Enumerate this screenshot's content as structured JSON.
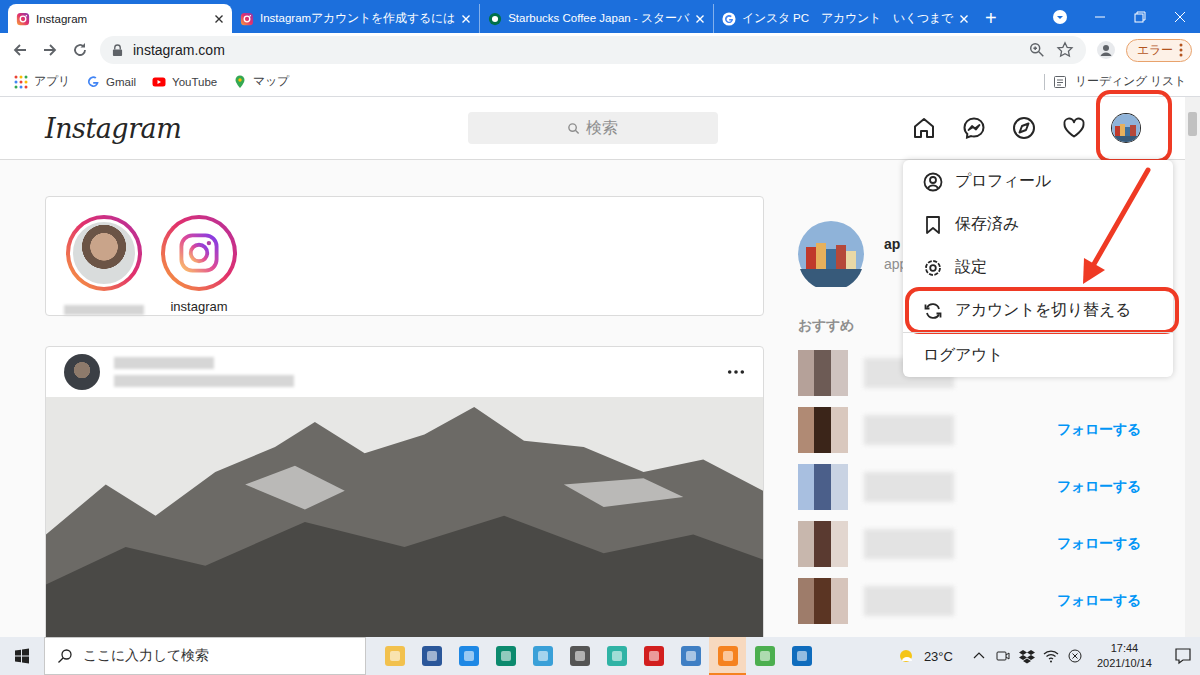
{
  "window": {
    "title": "Instagram"
  },
  "tabs": [
    {
      "label": "Instagram",
      "selected": true,
      "kind": "instagram"
    },
    {
      "label": "Instagramアカウントを作成するには",
      "selected": false,
      "kind": "instagram"
    },
    {
      "label": "Starbucks Coffee Japan - スターバ",
      "selected": false,
      "kind": "starbucks"
    },
    {
      "label": "インスタ PC　アカウント　いくつまで",
      "selected": false,
      "kind": "google"
    }
  ],
  "new_tab": "+",
  "toolbar": {
    "address": "instagram.com",
    "profile_status": "エラー"
  },
  "bookmarks": {
    "items": [
      {
        "label": "アプリ",
        "kind": "apps"
      },
      {
        "label": "Gmail",
        "kind": "gmail"
      },
      {
        "label": "YouTube",
        "kind": "youtube"
      },
      {
        "label": "マップ",
        "kind": "maps"
      }
    ],
    "reading_list": "リーディング リスト"
  },
  "instagram": {
    "logo": "Instagram",
    "search": {
      "placeholder": "検索"
    },
    "account": {
      "annotated": true,
      "menu_open": true
    },
    "stories": [
      {
        "name": null,
        "blurred": true
      },
      {
        "name": "instagram",
        "blurred": false
      }
    ],
    "me": {
      "username": "ap",
      "subtitle": "app"
    },
    "suggestions": {
      "title": "おすすめ",
      "rows": [
        {
          "follow": null
        },
        {
          "follow": "フォローする"
        },
        {
          "follow": "フォローする"
        },
        {
          "follow": "フォローする"
        },
        {
          "follow": "フォローする"
        }
      ]
    },
    "menu": [
      {
        "label": "プロフィール",
        "kind": "profile",
        "annotated": false
      },
      {
        "label": "保存済み",
        "kind": "saved",
        "annotated": false
      },
      {
        "label": "設定",
        "kind": "settings",
        "annotated": false
      },
      {
        "label": "アカウントを切り替える",
        "kind": "switch",
        "annotated": true
      },
      {
        "label": "ログアウト",
        "kind": "logout",
        "annotated": false
      }
    ]
  },
  "taskbar": {
    "search_placeholder": "ここに入力して検索",
    "weather": "23°C",
    "time": "17:44",
    "date": "2021/10/14"
  }
}
